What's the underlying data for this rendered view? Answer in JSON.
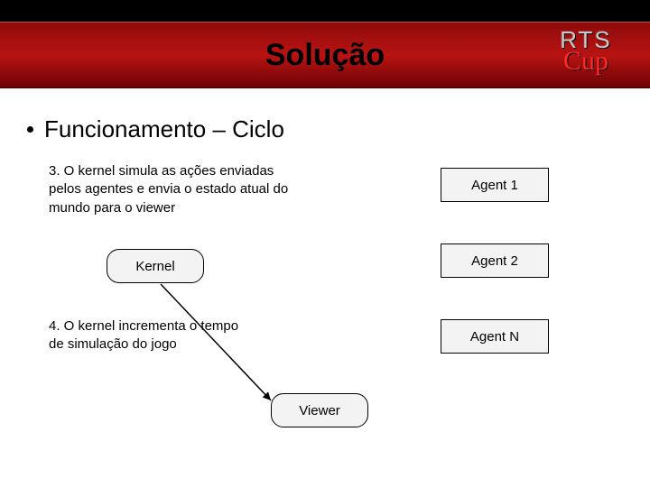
{
  "header": {
    "title": "Solução",
    "logo_top": "RTS",
    "logo_bottom": "Cup"
  },
  "bullet": {
    "text": "Funcionamento – Ciclo"
  },
  "steps": {
    "s3": "3. O kernel simula as ações enviadas pelos agentes e envia o estado atual do mundo para o viewer",
    "s4": "4. O kernel incrementa o tempo de simulação do jogo"
  },
  "nodes": {
    "kernel": "Kernel",
    "agent1": "Agent 1",
    "agent2": "Agent 2",
    "agentn": "Agent N",
    "viewer": "Viewer"
  }
}
